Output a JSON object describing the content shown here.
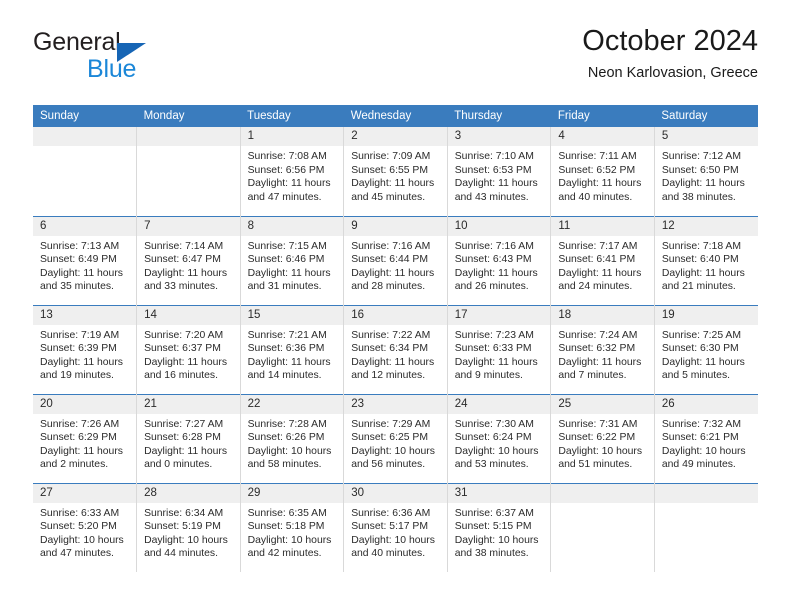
{
  "brand": {
    "name_top": "General",
    "name_bottom": "Blue",
    "triangle_icon": "brand-triangle-icon",
    "color_top": "#231f20",
    "color_bottom": "#1b87d8",
    "triangle_color": "#1665b5"
  },
  "header": {
    "title": "October 2024",
    "subtitle": "Neon Karlovasion, Greece"
  },
  "theme": {
    "header_bg": "#3a7cbe",
    "header_text": "#ffffff",
    "daynum_bg": "#efefef",
    "row_divider": "#3a7cbe",
    "cell_divider": "#d9d9d9",
    "body_text": "#2b2b2b"
  },
  "calendar": {
    "weekday_headers": [
      "Sunday",
      "Monday",
      "Tuesday",
      "Wednesday",
      "Thursday",
      "Friday",
      "Saturday"
    ],
    "labels": {
      "sunrise_prefix": "Sunrise:",
      "sunset_prefix": "Sunset:",
      "daylight_prefix": "Daylight:"
    },
    "weeks": [
      [
        {
          "day": "",
          "sunrise": "",
          "sunset": "",
          "daylight_line1": "",
          "daylight_line2": ""
        },
        {
          "day": "",
          "sunrise": "",
          "sunset": "",
          "daylight_line1": "",
          "daylight_line2": ""
        },
        {
          "day": "1",
          "sunrise": "Sunrise: 7:08 AM",
          "sunset": "Sunset: 6:56 PM",
          "daylight_line1": "Daylight: 11 hours",
          "daylight_line2": "and 47 minutes."
        },
        {
          "day": "2",
          "sunrise": "Sunrise: 7:09 AM",
          "sunset": "Sunset: 6:55 PM",
          "daylight_line1": "Daylight: 11 hours",
          "daylight_line2": "and 45 minutes."
        },
        {
          "day": "3",
          "sunrise": "Sunrise: 7:10 AM",
          "sunset": "Sunset: 6:53 PM",
          "daylight_line1": "Daylight: 11 hours",
          "daylight_line2": "and 43 minutes."
        },
        {
          "day": "4",
          "sunrise": "Sunrise: 7:11 AM",
          "sunset": "Sunset: 6:52 PM",
          "daylight_line1": "Daylight: 11 hours",
          "daylight_line2": "and 40 minutes."
        },
        {
          "day": "5",
          "sunrise": "Sunrise: 7:12 AM",
          "sunset": "Sunset: 6:50 PM",
          "daylight_line1": "Daylight: 11 hours",
          "daylight_line2": "and 38 minutes."
        }
      ],
      [
        {
          "day": "6",
          "sunrise": "Sunrise: 7:13 AM",
          "sunset": "Sunset: 6:49 PM",
          "daylight_line1": "Daylight: 11 hours",
          "daylight_line2": "and 35 minutes."
        },
        {
          "day": "7",
          "sunrise": "Sunrise: 7:14 AM",
          "sunset": "Sunset: 6:47 PM",
          "daylight_line1": "Daylight: 11 hours",
          "daylight_line2": "and 33 minutes."
        },
        {
          "day": "8",
          "sunrise": "Sunrise: 7:15 AM",
          "sunset": "Sunset: 6:46 PM",
          "daylight_line1": "Daylight: 11 hours",
          "daylight_line2": "and 31 minutes."
        },
        {
          "day": "9",
          "sunrise": "Sunrise: 7:16 AM",
          "sunset": "Sunset: 6:44 PM",
          "daylight_line1": "Daylight: 11 hours",
          "daylight_line2": "and 28 minutes."
        },
        {
          "day": "10",
          "sunrise": "Sunrise: 7:16 AM",
          "sunset": "Sunset: 6:43 PM",
          "daylight_line1": "Daylight: 11 hours",
          "daylight_line2": "and 26 minutes."
        },
        {
          "day": "11",
          "sunrise": "Sunrise: 7:17 AM",
          "sunset": "Sunset: 6:41 PM",
          "daylight_line1": "Daylight: 11 hours",
          "daylight_line2": "and 24 minutes."
        },
        {
          "day": "12",
          "sunrise": "Sunrise: 7:18 AM",
          "sunset": "Sunset: 6:40 PM",
          "daylight_line1": "Daylight: 11 hours",
          "daylight_line2": "and 21 minutes."
        }
      ],
      [
        {
          "day": "13",
          "sunrise": "Sunrise: 7:19 AM",
          "sunset": "Sunset: 6:39 PM",
          "daylight_line1": "Daylight: 11 hours",
          "daylight_line2": "and 19 minutes."
        },
        {
          "day": "14",
          "sunrise": "Sunrise: 7:20 AM",
          "sunset": "Sunset: 6:37 PM",
          "daylight_line1": "Daylight: 11 hours",
          "daylight_line2": "and 16 minutes."
        },
        {
          "day": "15",
          "sunrise": "Sunrise: 7:21 AM",
          "sunset": "Sunset: 6:36 PM",
          "daylight_line1": "Daylight: 11 hours",
          "daylight_line2": "and 14 minutes."
        },
        {
          "day": "16",
          "sunrise": "Sunrise: 7:22 AM",
          "sunset": "Sunset: 6:34 PM",
          "daylight_line1": "Daylight: 11 hours",
          "daylight_line2": "and 12 minutes."
        },
        {
          "day": "17",
          "sunrise": "Sunrise: 7:23 AM",
          "sunset": "Sunset: 6:33 PM",
          "daylight_line1": "Daylight: 11 hours",
          "daylight_line2": "and 9 minutes."
        },
        {
          "day": "18",
          "sunrise": "Sunrise: 7:24 AM",
          "sunset": "Sunset: 6:32 PM",
          "daylight_line1": "Daylight: 11 hours",
          "daylight_line2": "and 7 minutes."
        },
        {
          "day": "19",
          "sunrise": "Sunrise: 7:25 AM",
          "sunset": "Sunset: 6:30 PM",
          "daylight_line1": "Daylight: 11 hours",
          "daylight_line2": "and 5 minutes."
        }
      ],
      [
        {
          "day": "20",
          "sunrise": "Sunrise: 7:26 AM",
          "sunset": "Sunset: 6:29 PM",
          "daylight_line1": "Daylight: 11 hours",
          "daylight_line2": "and 2 minutes."
        },
        {
          "day": "21",
          "sunrise": "Sunrise: 7:27 AM",
          "sunset": "Sunset: 6:28 PM",
          "daylight_line1": "Daylight: 11 hours",
          "daylight_line2": "and 0 minutes."
        },
        {
          "day": "22",
          "sunrise": "Sunrise: 7:28 AM",
          "sunset": "Sunset: 6:26 PM",
          "daylight_line1": "Daylight: 10 hours",
          "daylight_line2": "and 58 minutes."
        },
        {
          "day": "23",
          "sunrise": "Sunrise: 7:29 AM",
          "sunset": "Sunset: 6:25 PM",
          "daylight_line1": "Daylight: 10 hours",
          "daylight_line2": "and 56 minutes."
        },
        {
          "day": "24",
          "sunrise": "Sunrise: 7:30 AM",
          "sunset": "Sunset: 6:24 PM",
          "daylight_line1": "Daylight: 10 hours",
          "daylight_line2": "and 53 minutes."
        },
        {
          "day": "25",
          "sunrise": "Sunrise: 7:31 AM",
          "sunset": "Sunset: 6:22 PM",
          "daylight_line1": "Daylight: 10 hours",
          "daylight_line2": "and 51 minutes."
        },
        {
          "day": "26",
          "sunrise": "Sunrise: 7:32 AM",
          "sunset": "Sunset: 6:21 PM",
          "daylight_line1": "Daylight: 10 hours",
          "daylight_line2": "and 49 minutes."
        }
      ],
      [
        {
          "day": "27",
          "sunrise": "Sunrise: 6:33 AM",
          "sunset": "Sunset: 5:20 PM",
          "daylight_line1": "Daylight: 10 hours",
          "daylight_line2": "and 47 minutes."
        },
        {
          "day": "28",
          "sunrise": "Sunrise: 6:34 AM",
          "sunset": "Sunset: 5:19 PM",
          "daylight_line1": "Daylight: 10 hours",
          "daylight_line2": "and 44 minutes."
        },
        {
          "day": "29",
          "sunrise": "Sunrise: 6:35 AM",
          "sunset": "Sunset: 5:18 PM",
          "daylight_line1": "Daylight: 10 hours",
          "daylight_line2": "and 42 minutes."
        },
        {
          "day": "30",
          "sunrise": "Sunrise: 6:36 AM",
          "sunset": "Sunset: 5:17 PM",
          "daylight_line1": "Daylight: 10 hours",
          "daylight_line2": "and 40 minutes."
        },
        {
          "day": "31",
          "sunrise": "Sunrise: 6:37 AM",
          "sunset": "Sunset: 5:15 PM",
          "daylight_line1": "Daylight: 10 hours",
          "daylight_line2": "and 38 minutes."
        },
        {
          "day": "",
          "sunrise": "",
          "sunset": "",
          "daylight_line1": "",
          "daylight_line2": ""
        },
        {
          "day": "",
          "sunrise": "",
          "sunset": "",
          "daylight_line1": "",
          "daylight_line2": ""
        }
      ]
    ]
  }
}
